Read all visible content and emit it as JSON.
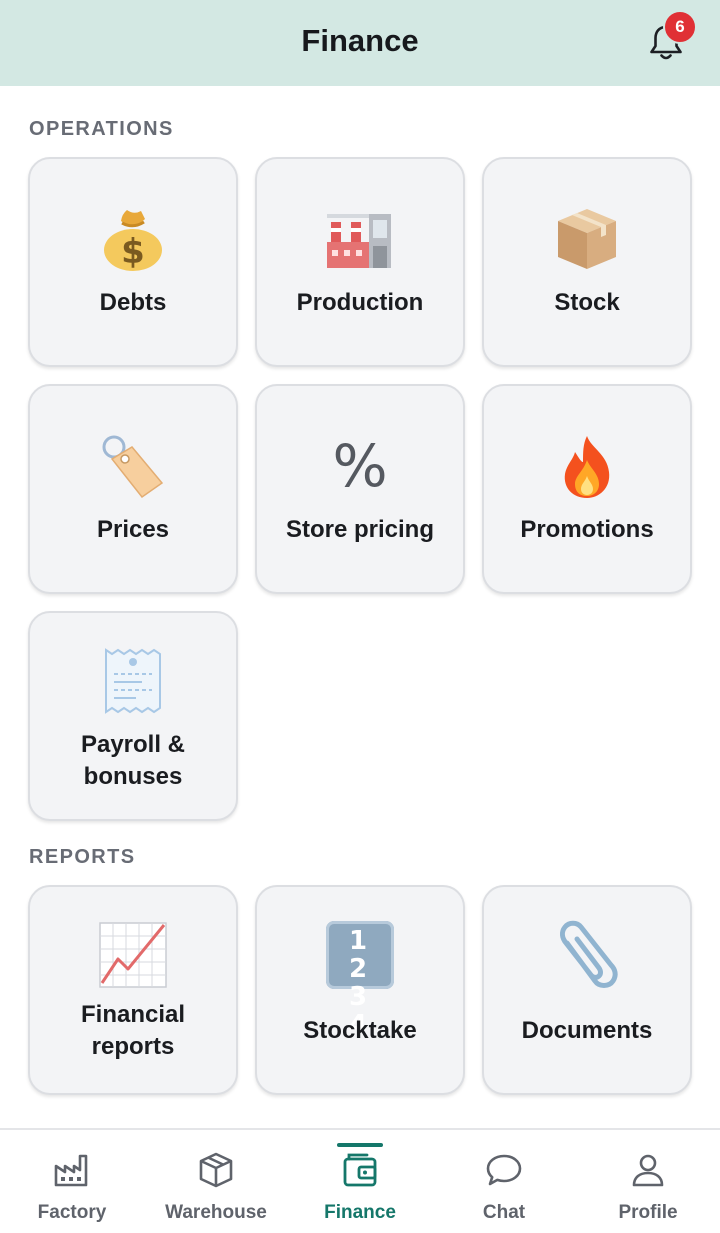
{
  "header": {
    "title": "Finance",
    "notification_count": "6"
  },
  "sections": {
    "operations": {
      "label": "OPERATIONS",
      "tiles": [
        {
          "label": "Debts",
          "icon": "money-bag-icon"
        },
        {
          "label": "Production",
          "icon": "factory-icon"
        },
        {
          "label": "Stock",
          "icon": "package-icon"
        },
        {
          "label": "Prices",
          "icon": "price-tag-icon"
        },
        {
          "label": "Store pricing",
          "icon": "percent-icon",
          "glyph": "%"
        },
        {
          "label": "Promotions",
          "icon": "fire-icon"
        },
        {
          "label_line1": "Payroll &",
          "label_line2": "bonuses",
          "icon": "receipt-icon"
        }
      ]
    },
    "reports": {
      "label": "REPORTS",
      "tiles": [
        {
          "label_line1": "Financial",
          "label_line2": "reports",
          "icon": "chart-increasing-icon"
        },
        {
          "label": "Stocktake",
          "icon": "input-numbers-icon",
          "glyph": "1 2 3 4"
        },
        {
          "label": "Documents",
          "icon": "paperclip-icon"
        }
      ]
    }
  },
  "bottom_nav": {
    "active": "Finance",
    "items": [
      {
        "label": "Factory",
        "icon": "factory-outline-icon"
      },
      {
        "label": "Warehouse",
        "icon": "box-outline-icon"
      },
      {
        "label": "Finance",
        "icon": "wallet-outline-icon"
      },
      {
        "label": "Chat",
        "icon": "chat-bubble-icon"
      },
      {
        "label": "Profile",
        "icon": "person-icon"
      }
    ]
  },
  "colors": {
    "header_bg": "#d3e8e3",
    "accent": "#15776a",
    "badge": "#e03035",
    "tile_bg": "#f3f4f6"
  }
}
